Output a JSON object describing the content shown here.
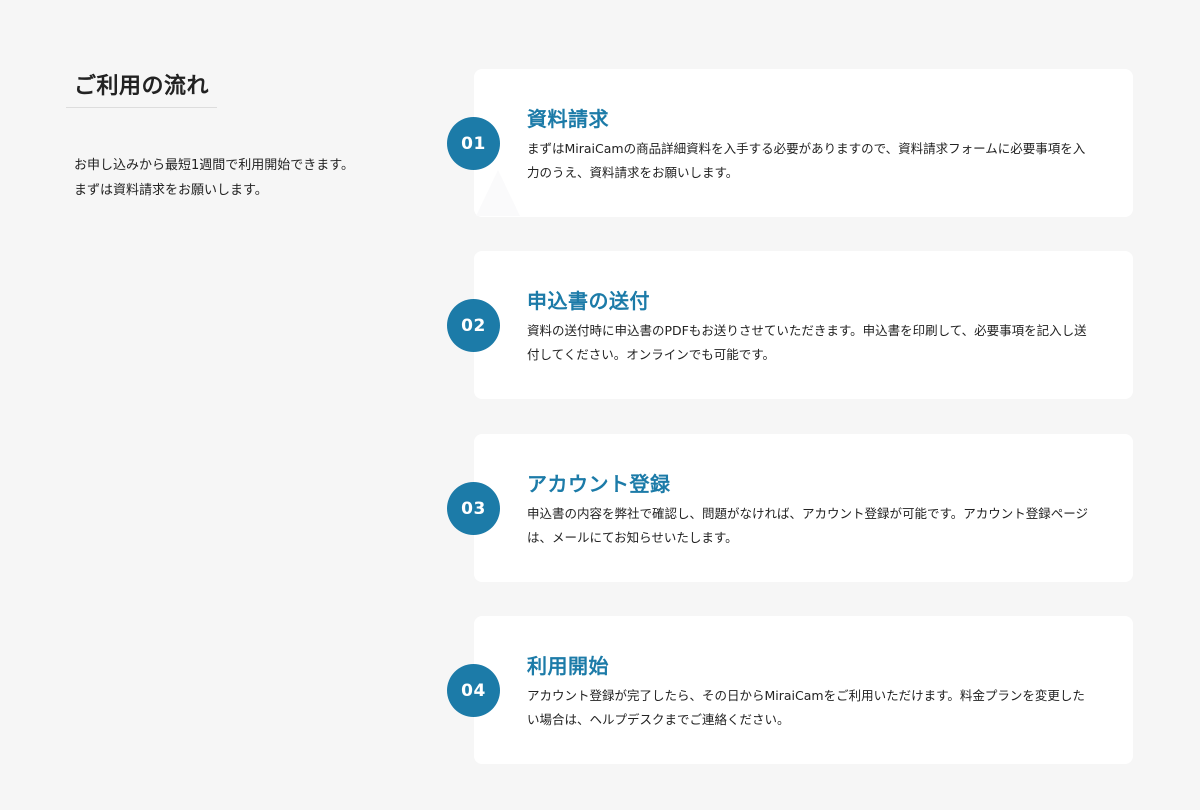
{
  "intro": {
    "title": "ご利用の流れ",
    "text": "お申し込みから最短1週間で利用開始できます。\nまずは資料請求をお願いします。"
  },
  "steps": [
    {
      "number": "01",
      "title": "資料請求",
      "description": "まずはMiraiCamの商品詳細資料を入手する必要がありますので、資料請求フォームに必要事項を入力のうえ、資料請求をお願いします。"
    },
    {
      "number": "02",
      "title": "申込書の送付",
      "description": "資料の送付時に申込書のPDFもお送りさせていただきます。申込書を印刷して、必要事項を記入し送付してください。オンラインでも可能です。"
    },
    {
      "number": "03",
      "title": "アカウント登録",
      "description": "申込書の内容を弊社で確認し、問題がなければ、アカウント登録が可能です。アカウント登録ページは、メールにてお知らせいたします。"
    },
    {
      "number": "04",
      "title": "利用開始",
      "description": "アカウント登録が完了したら、その日からMiraiCamをご利用いただけます。料金プランを変更したい場合は、ヘルプデスクまでご連絡ください。"
    }
  ],
  "colors": {
    "accent": "#1c7ba8",
    "background": "#f6f6f6",
    "card": "#ffffff",
    "text": "#222222"
  }
}
